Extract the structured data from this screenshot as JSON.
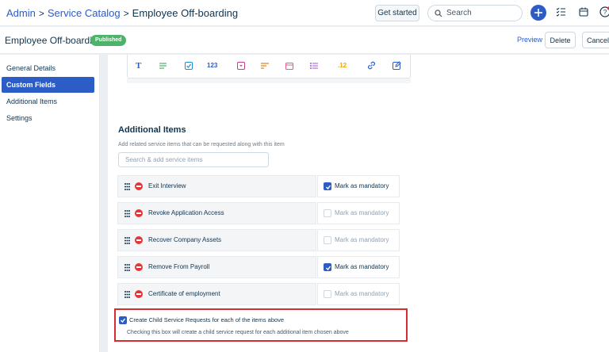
{
  "breadcrumb": {
    "admin": "Admin",
    "sep1": ">",
    "catalog": "Service Catalog",
    "sep2": ">",
    "current": "Employee Off-boarding"
  },
  "header": {
    "get_started": "Get started",
    "search_placeholder": "Search"
  },
  "item": {
    "title": "Employee Off-boarding",
    "status": "Published",
    "preview": "Preview",
    "delete": "Delete",
    "cancel": "Cancel"
  },
  "sidebar": {
    "items": [
      {
        "label": "General Details",
        "active": false
      },
      {
        "label": "Custom Fields",
        "active": true
      },
      {
        "label": "Additional Items",
        "active": false
      },
      {
        "label": "Settings",
        "active": false
      }
    ]
  },
  "toolbox": {
    "icons": [
      "text-icon",
      "paragraph-icon",
      "checkbox-icon",
      "number-icon",
      "dropdown-icon",
      "multiline-icon",
      "date-icon",
      "multiselect-icon",
      "decimal-icon",
      "link-icon",
      "edit-icon"
    ],
    "number_label": "123",
    "decimal_label": ".12",
    "text_label": "T"
  },
  "additional": {
    "title": "Additional Items",
    "desc": "Add related service items that can be requested along with this item",
    "placeholder": "Search & add service items",
    "mandatory_label": "Mark as mandatory",
    "rows": [
      {
        "label": "Exit Interview",
        "mandatory": true
      },
      {
        "label": "Revoke Application Access",
        "mandatory": false
      },
      {
        "label": "Recover Company Assets",
        "mandatory": false
      },
      {
        "label": "Remove From Payroll",
        "mandatory": true
      },
      {
        "label": "Certificate of employment",
        "mandatory": false
      }
    ]
  },
  "child_requests": {
    "checked": true,
    "title": "Create Child Service Requests for each of the items above",
    "desc": "Checking this box will create a child service request for each additional item chosen above"
  },
  "colors": {
    "accent": "#2c5cc5",
    "published": "#4cb369",
    "remove": "#e43538",
    "highlight": "#d72d30"
  }
}
